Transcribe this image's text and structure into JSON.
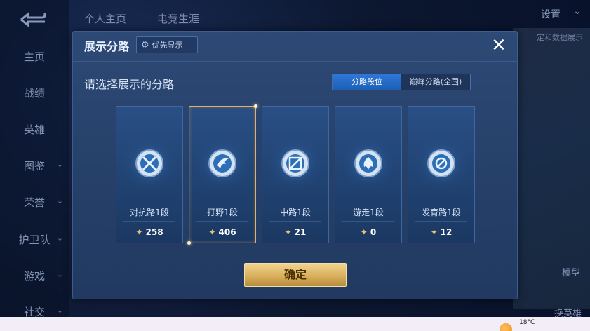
{
  "background": {
    "tabs": [
      "个人主页",
      "电竞生涯"
    ],
    "sidebar": [
      {
        "label": "主页",
        "chevron": false
      },
      {
        "label": "战绩",
        "chevron": false
      },
      {
        "label": "英雄",
        "chevron": false
      },
      {
        "label": "图鉴",
        "chevron": true
      },
      {
        "label": "荣誉",
        "chevron": true
      },
      {
        "label": "护卫队",
        "chevron": true
      },
      {
        "label": "游戏",
        "chevron": true
      },
      {
        "label": "社交",
        "chevron": true
      }
    ],
    "settings_label": "设置",
    "right_hint": "定和数据展示",
    "right_bottom_1": "模型",
    "right_bottom_2": "换英雄"
  },
  "modal": {
    "title": "展示分路",
    "priority_label": "优先显示",
    "close_icon": "close-icon",
    "prompt": "请选择展示的分路",
    "tabs": [
      {
        "label": "分路段位",
        "active": true
      },
      {
        "label": "巅峰分路(全国)",
        "active": false
      }
    ],
    "lanes": [
      {
        "name": "对抗路1段",
        "score": "258",
        "icon": "clash-lane-icon",
        "selected": false
      },
      {
        "name": "打野1段",
        "score": "406",
        "icon": "jungle-icon",
        "selected": true
      },
      {
        "name": "中路1段",
        "score": "21",
        "icon": "mid-lane-icon",
        "selected": false
      },
      {
        "name": "游走1段",
        "score": "0",
        "icon": "roam-icon",
        "selected": false
      },
      {
        "name": "发育路1段",
        "score": "12",
        "icon": "farm-lane-icon",
        "selected": false
      }
    ],
    "confirm_label": "确定"
  },
  "taskbar": {
    "temperature": "18°C"
  },
  "colors": {
    "accent_gold": "#e3b164",
    "tab_active": "#2d78d8",
    "panel": "#2d4975"
  }
}
